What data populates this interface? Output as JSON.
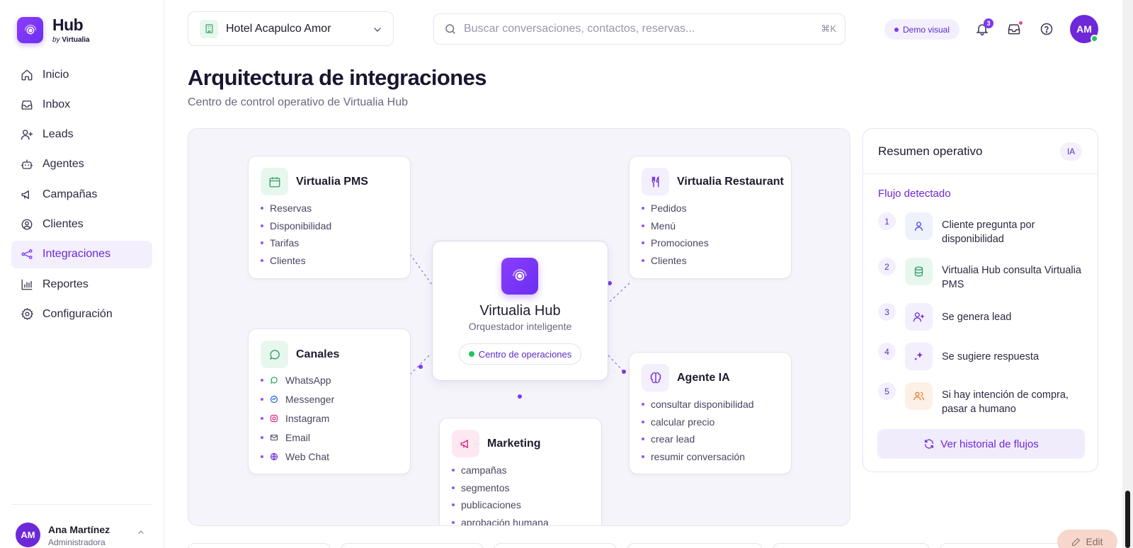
{
  "brand": {
    "title": "Hub",
    "by_prefix": "by",
    "by_name": "Virtualia"
  },
  "sidebar": {
    "items": [
      {
        "label": "Inicio",
        "icon": "home-icon",
        "active": false
      },
      {
        "label": "Inbox",
        "icon": "inbox-icon",
        "active": false
      },
      {
        "label": "Leads",
        "icon": "user-plus-icon",
        "active": false
      },
      {
        "label": "Agentes",
        "icon": "bot-icon",
        "active": false
      },
      {
        "label": "Campañas",
        "icon": "megaphone-icon",
        "active": false
      },
      {
        "label": "Clientes",
        "icon": "user-circle-icon",
        "active": false
      },
      {
        "label": "Integraciones",
        "icon": "integrations-icon",
        "active": true
      },
      {
        "label": "Reportes",
        "icon": "bar-chart-icon",
        "active": false
      },
      {
        "label": "Configuración",
        "icon": "gear-icon",
        "active": false
      }
    ],
    "user": {
      "initials": "AM",
      "name": "Ana Martínez",
      "role": "Administradora"
    }
  },
  "topbar": {
    "hotel": "Hotel Acapulco Amor",
    "search_placeholder": "Buscar conversaciones, contactos, reservas...",
    "search_shortcut": "⌘K",
    "demo_badge": "Demo visual",
    "notif_count": "3",
    "avatar_initials": "AM"
  },
  "page": {
    "title": "Arquitectura de integraciones",
    "subtitle": "Centro de control operativo de Virtualia Hub"
  },
  "diagram": {
    "hub": {
      "title": "Virtualia Hub",
      "subtitle": "Orquestador inteligente",
      "button": "Centro de operaciones"
    },
    "pms": {
      "title": "Virtualia PMS",
      "items": [
        "Reservas",
        "Disponibilidad",
        "Tarifas",
        "Clientes"
      ]
    },
    "restaurant": {
      "title": "Virtualia Restaurant",
      "items": [
        "Pedidos",
        "Menú",
        "Promociones",
        "Clientes"
      ]
    },
    "canales": {
      "title": "Canales",
      "items": [
        "WhatsApp",
        "Messenger",
        "Instagram",
        "Email",
        "Web Chat"
      ]
    },
    "agente": {
      "title": "Agente IA",
      "items": [
        "consultar disponibilidad",
        "calcular precio",
        "crear lead",
        "resumir conversación"
      ]
    },
    "marketing": {
      "title": "Marketing",
      "items": [
        "campañas",
        "segmentos",
        "publicaciones",
        "aprobación humana"
      ]
    }
  },
  "summary": {
    "title": "Resumen operativo",
    "badge": "IA",
    "subtitle": "Flujo detectado",
    "steps": [
      {
        "n": "1",
        "text": "Cliente pregunta por disponibilidad",
        "icon": "user-icon"
      },
      {
        "n": "2",
        "text": "Virtualia Hub consulta Virtualia PMS",
        "icon": "database-icon"
      },
      {
        "n": "3",
        "text": "Se genera lead",
        "icon": "user-plus-icon"
      },
      {
        "n": "4",
        "text": "Se sugiere respuesta",
        "icon": "sparkles-icon"
      },
      {
        "n": "5",
        "text": "Si hay intención de compra, pasar a humano",
        "icon": "users-icon"
      }
    ],
    "history_button": "Ver historial de flujos"
  },
  "edit_button": "Edit",
  "colors": {
    "accent": "#7c3aed",
    "accent_soft": "#f3effd",
    "green": "#22c55e",
    "canvas": "#f5f4fb"
  }
}
